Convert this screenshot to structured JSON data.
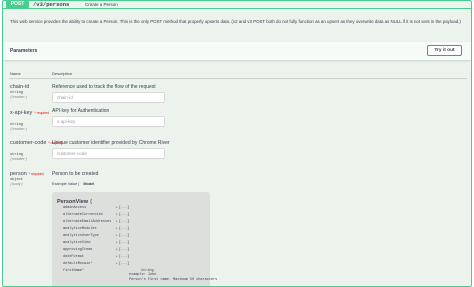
{
  "operation": {
    "method": "POST",
    "path": "/v3/persons",
    "summary": "Create a Person",
    "description": "This web service provides the ability to create a Person. This is the only POST method that properly upserts data. (v2 and v3 POST both do not fully function as an upsert as they overwrite data as NULL if it is not sent in the payload.)"
  },
  "parameters_section": {
    "title": "Parameters",
    "try_button": "Try it out",
    "col_name": "Name",
    "col_description": "Description"
  },
  "params": [
    {
      "name": "chain-id",
      "required": "",
      "type": "string",
      "in": "(header)",
      "description": "Reference used to track the flow of the request",
      "placeholder": "chain-id"
    },
    {
      "name": "x-api-key",
      "required": "* required",
      "type": "string",
      "in": "(header)",
      "description": "API key for Authentication",
      "placeholder": "x-api-key"
    },
    {
      "name": "customer-code",
      "required": "* required",
      "type": "string",
      "in": "(header)",
      "description": "Unique customer identifier provided by Chrome River",
      "placeholder": "customer-code"
    },
    {
      "name": "person",
      "required": "* required",
      "type": "object",
      "in": "(body)",
      "description": "Person to be created"
    }
  ],
  "example_line": {
    "prefix": "Example Value",
    "model": "Model"
  },
  "model": {
    "title": "PersonView",
    "brace": "{",
    "properties": [
      {
        "name": "adminAccess",
        "value": "[...]"
      },
      {
        "name": "alternateCurrencies",
        "value": "[...]"
      },
      {
        "name": "alternateEmailAddresses",
        "value": "[...]"
      },
      {
        "name": "analyticsModules",
        "value": "[...]"
      },
      {
        "name": "analyticsUserType",
        "value": "[...]"
      },
      {
        "name": "analyticsView",
        "value": "[...]"
      },
      {
        "name": "approvingItems",
        "value": "[...]"
      },
      {
        "name": "dateFormat",
        "value": "[...]"
      },
      {
        "name": "defaultMosaic*",
        "value": "[...]"
      }
    ],
    "first_name": {
      "name": "firstName*",
      "type": "string",
      "example": "example: John",
      "note": "Person's First name. Maximum 50 characters"
    }
  }
}
